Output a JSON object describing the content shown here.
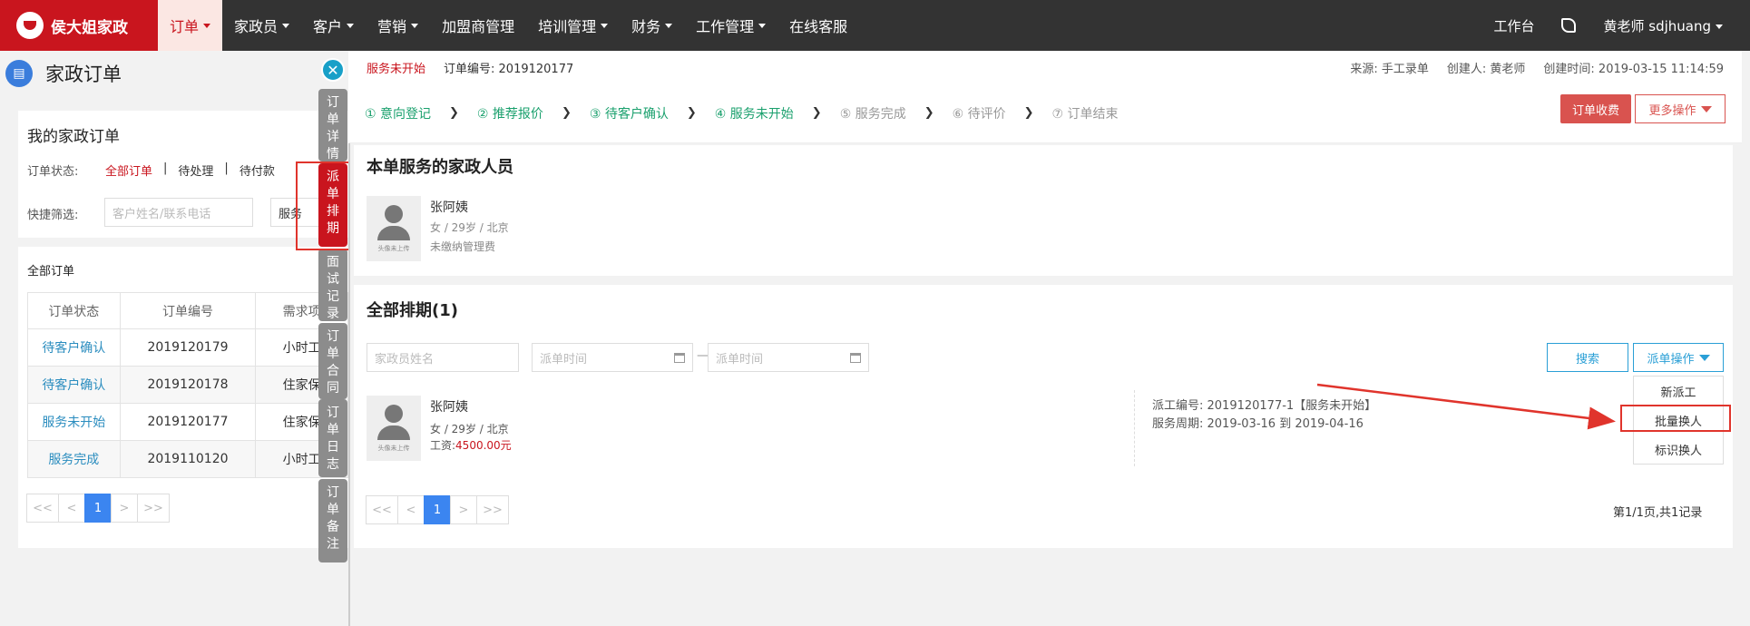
{
  "topbar": {
    "brand": "侯大姐家政",
    "nav": [
      {
        "label": "订单",
        "caret": true,
        "active": true
      },
      {
        "label": "家政员",
        "caret": true
      },
      {
        "label": "客户",
        "caret": true
      },
      {
        "label": "营销",
        "caret": true
      },
      {
        "label": "加盟商管理",
        "caret": false
      },
      {
        "label": "培训管理",
        "caret": true
      },
      {
        "label": "财务",
        "caret": true
      },
      {
        "label": "工作管理",
        "caret": true
      },
      {
        "label": "在线客服",
        "caret": false
      }
    ],
    "workbench": "工作台",
    "user": "黄老师  sdjhuang"
  },
  "page": {
    "title": "家政订单"
  },
  "my_orders": {
    "title": "我的家政订单",
    "status_label": "订单状态:",
    "status_tabs": [
      "全部订单",
      "待处理",
      "待付款"
    ],
    "quick_filter_label": "快捷筛选:",
    "search_placeholder": "客户姓名/联系电话",
    "service_filter": "服务"
  },
  "all_orders": {
    "title": "全部订单",
    "columns": [
      "订单状态",
      "订单编号",
      "需求项"
    ],
    "rows": [
      {
        "status": "待客户确认",
        "id": "2019120179",
        "need": "小时工"
      },
      {
        "status": "待客户确认",
        "id": "2019120178",
        "need": "住家保"
      },
      {
        "status": "服务未开始",
        "id": "2019120177",
        "need": "住家保"
      },
      {
        "status": "服务完成",
        "id": "2019110120",
        "need": "小时工"
      }
    ],
    "pager": [
      "<<",
      "<",
      "1",
      ">",
      ">>"
    ]
  },
  "side_tabs": [
    {
      "label": "订单详情",
      "active": false
    },
    {
      "label": "派单排期",
      "active": true
    },
    {
      "label": "面试记录",
      "active": false
    },
    {
      "label": "订单合同",
      "active": false
    },
    {
      "label": "订单日志",
      "active": false
    },
    {
      "label": "订单备注",
      "active": false
    }
  ],
  "detail": {
    "status": "服务未开始",
    "order_no": "订单编号: 2019120177",
    "source": "来源: 手工录单",
    "creator": "创建人: 黄老师",
    "created_at": "创建时间: 2019-03-15 11:14:59",
    "steps": [
      {
        "label": "① 意向登记",
        "done": true
      },
      {
        "label": "② 推荐报价",
        "done": true
      },
      {
        "label": "③ 待客户确认",
        "done": true
      },
      {
        "label": "④ 服务未开始",
        "done": true
      },
      {
        "label": "⑤ 服务完成",
        "done": false
      },
      {
        "label": "⑥ 待评价",
        "done": false
      },
      {
        "label": "⑦ 订单结束",
        "done": false
      }
    ],
    "btn_charge": "订单收费",
    "btn_more": "更多操作"
  },
  "staff_section": {
    "title": "本单服务的家政人员",
    "avatar_caption": "头像未上传",
    "name": "张阿姨",
    "meta": "女 / 29岁 / 北京",
    "fee": "未缴纳管理费"
  },
  "schedule_section": {
    "title": "全部排期(1)",
    "name_placeholder": "家政员姓名",
    "date_placeholder_start": "派单时间",
    "date_placeholder_end": "派单时间",
    "search_btn": "搜索",
    "dispatch_btn": "派单操作",
    "dispatch_menu": [
      "新派工",
      "批量换人",
      "标识换人"
    ],
    "record": {
      "avatar_caption": "头像未上传",
      "name": "张阿姨",
      "meta": "女 / 29岁 / 北京",
      "wage_label": "工资:",
      "wage": "4500.00元",
      "dispatch_no": "派工编号: 2019120177-1【服务未开始】",
      "period": "服务周期: 2019-03-16 到 2019-04-16"
    },
    "pager": [
      "<<",
      "<",
      "1",
      ">",
      ">>"
    ],
    "summary": "第1/1页,共1记录"
  },
  "colors": {
    "brand_red": "#c9151e",
    "step_green": "#1aa06d",
    "link_blue": "#2b8dbf",
    "annotation_red": "#e0342c"
  }
}
